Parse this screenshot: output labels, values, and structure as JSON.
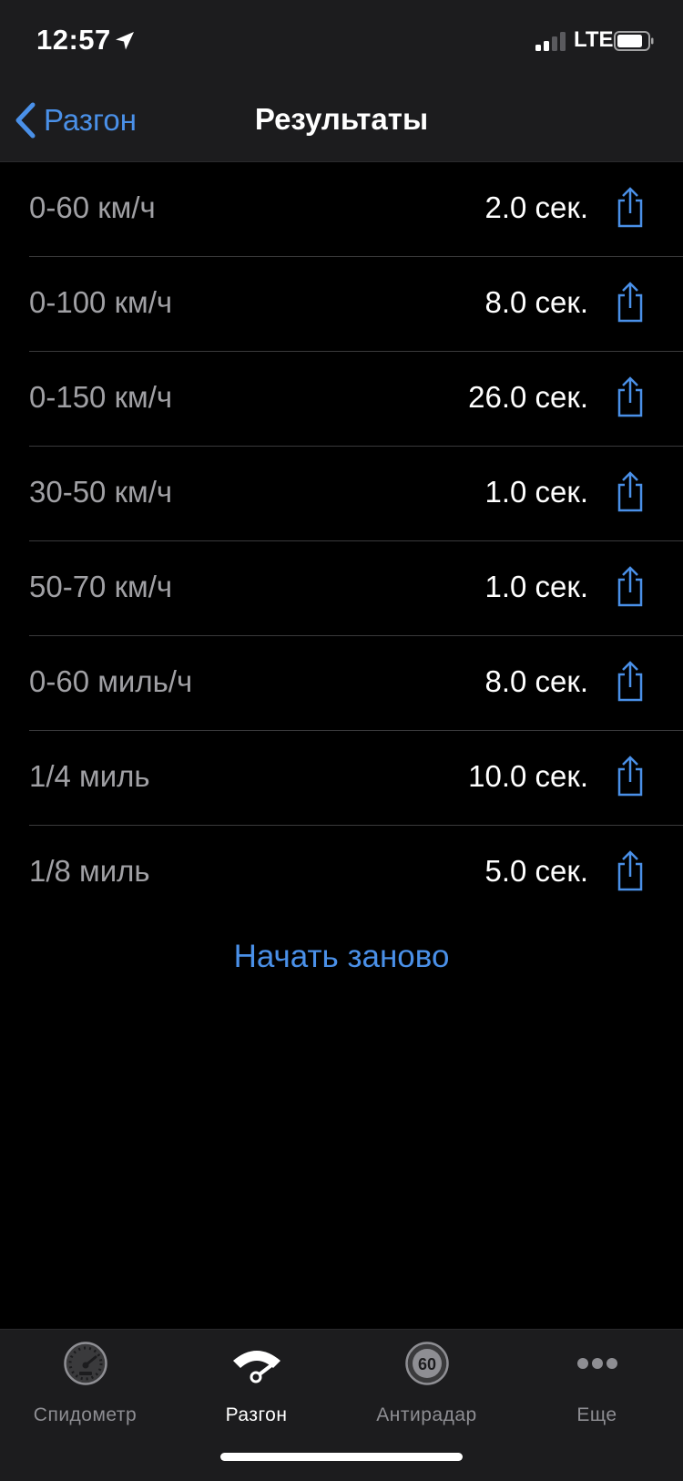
{
  "status_bar": {
    "time": "12:57",
    "network": "LTE"
  },
  "nav": {
    "back_label": "Разгон",
    "title": "Результаты"
  },
  "results": [
    {
      "label": "0-60 км/ч",
      "value": "2.0 сек."
    },
    {
      "label": "0-100 км/ч",
      "value": "8.0 сек."
    },
    {
      "label": "0-150 км/ч",
      "value": "26.0 сек."
    },
    {
      "label": "30-50 км/ч",
      "value": "1.0 сек."
    },
    {
      "label": "50-70 км/ч",
      "value": "1.0 сек."
    },
    {
      "label": "0-60 миль/ч",
      "value": "8.0 сек."
    },
    {
      "label": "1/4 миль",
      "value": "10.0 сек."
    },
    {
      "label": "1/8 миль",
      "value": "5.0 сек."
    }
  ],
  "restart_label": "Начать заново",
  "tabs": [
    {
      "label": "Спидометр",
      "icon": "speedometer-icon",
      "active": false
    },
    {
      "label": "Разгон",
      "icon": "acceleration-icon",
      "active": true
    },
    {
      "label": "Антирадар",
      "icon": "speed-limit-icon",
      "active": false,
      "icon_text": "60"
    },
    {
      "label": "Еще",
      "icon": "more-icon",
      "active": false
    }
  ],
  "colors": {
    "accent": "#4a90e8",
    "background": "#000000",
    "bar_background": "#1c1c1e",
    "label_gray": "#a0a0a4"
  }
}
